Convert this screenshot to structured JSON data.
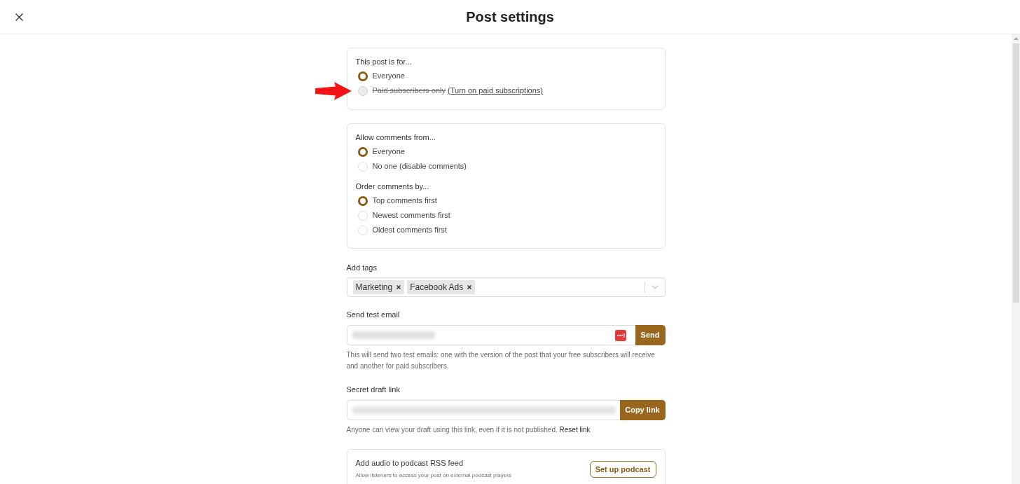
{
  "header": {
    "title": "Post settings"
  },
  "audience": {
    "label": "This post is for...",
    "options": [
      {
        "label": "Everyone",
        "selected": true,
        "disabled": false
      },
      {
        "label": "Paid subscribers only",
        "selected": false,
        "disabled": true,
        "link": "(Turn on paid subscriptions)"
      }
    ]
  },
  "comments": {
    "groups": [
      {
        "label": "Allow comments from...",
        "options": [
          {
            "label": "Everyone",
            "selected": true
          },
          {
            "label": "No one (disable comments)",
            "selected": false
          }
        ]
      },
      {
        "label": "Order comments by...",
        "options": [
          {
            "label": "Top comments first",
            "selected": true
          },
          {
            "label": "Newest comments first",
            "selected": false
          },
          {
            "label": "Oldest comments first",
            "selected": false
          }
        ]
      }
    ]
  },
  "tags": {
    "label": "Add tags",
    "items": [
      "Marketing",
      "Facebook Ads"
    ]
  },
  "test_email": {
    "label": "Send test email",
    "button": "Send",
    "hint": "This will send two test emails: one with the version of the post that your free subscribers will receive and another for paid subscribers."
  },
  "draft_link": {
    "label": "Secret draft link",
    "button": "Copy link",
    "hint": "Anyone can view your draft using this link, even if it is not published.",
    "link": "Reset link"
  },
  "podcast": {
    "title": "Add audio to podcast RSS feed",
    "subtitle": "Allow listeners to access your post on external podcast players",
    "button": "Set up podcast"
  }
}
